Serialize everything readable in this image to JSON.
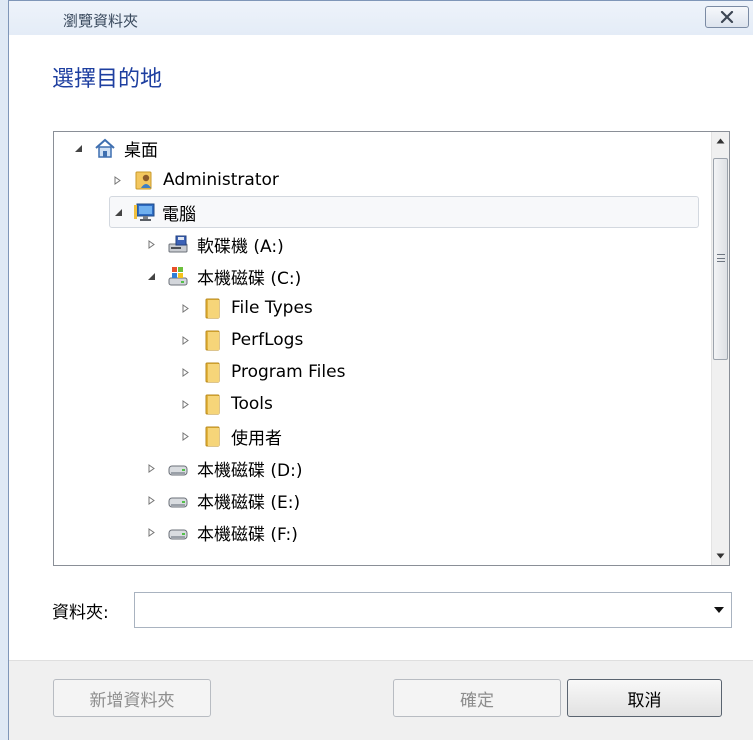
{
  "window": {
    "title": "瀏覽資料夾",
    "heading": "選擇目的地"
  },
  "tree": {
    "items": [
      {
        "label": "桌面",
        "icon": "desktop-icon",
        "expanded": true,
        "arrow": "expanded"
      },
      {
        "label": "Administrator",
        "icon": "user-folder-icon",
        "arrow": "collapsed"
      },
      {
        "label": "電腦",
        "icon": "computer-icon",
        "arrow": "expanded",
        "selected": true
      },
      {
        "label": "軟碟機 (A:)",
        "icon": "floppy-drive-icon",
        "arrow": "collapsed"
      },
      {
        "label": "本機磁碟 (C:)",
        "icon": "system-drive-icon",
        "arrow": "expanded"
      },
      {
        "label": "File Types",
        "icon": "folder-icon",
        "arrow": "collapsed"
      },
      {
        "label": "PerfLogs",
        "icon": "folder-icon",
        "arrow": "collapsed"
      },
      {
        "label": "Program Files",
        "icon": "folder-icon",
        "arrow": "collapsed"
      },
      {
        "label": "Tools",
        "icon": "folder-icon",
        "arrow": "collapsed"
      },
      {
        "label": "使用者",
        "icon": "folder-icon",
        "arrow": "collapsed"
      },
      {
        "label": "本機磁碟 (D:)",
        "icon": "hard-drive-icon",
        "arrow": "collapsed"
      },
      {
        "label": "本機磁碟 (E:)",
        "icon": "hard-drive-icon",
        "arrow": "collapsed"
      },
      {
        "label": "本機磁碟 (F:)",
        "icon": "hard-drive-icon",
        "arrow": "collapsed"
      }
    ]
  },
  "folder_field": {
    "label": "資料夾:",
    "value": ""
  },
  "buttons": {
    "new_folder": "新增資料夾",
    "ok": "確定",
    "cancel": "取消"
  },
  "colors": {
    "heading": "#1e3fa0",
    "title_bar": "#e9eff8",
    "footer": "#f0f0f0"
  }
}
